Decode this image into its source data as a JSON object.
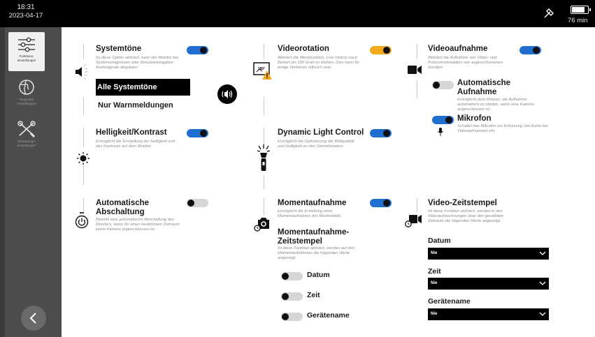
{
  "status_bar": {
    "time": "18:31",
    "date": "2023-04-17",
    "battery_text": "76 min",
    "battery_level_percent": 85
  },
  "sidebar": {
    "items": [
      {
        "label": "Funktions-\neinstellungen",
        "icon": "sliders-icon",
        "active": true
      },
      {
        "label": "Regionale\nEinstellungen",
        "icon": "globe-icon",
        "active": false
      },
      {
        "label": "Verwaltungs-\neinstellungen",
        "icon": "tools-icon",
        "active": false
      }
    ],
    "back_icon": "chevron-left-icon"
  },
  "settings": {
    "systemtoene": {
      "title": "Systemtöne",
      "desc": "Ist diese Option aktiviert, kann der Monitor bei Systemereignissen oder Benutzereingaben Audiosignale abspielen.",
      "on": true,
      "options": [
        "Alle Systemtöne",
        "Nur Warnmeldungen"
      ],
      "selected": "Alle Systemtöne"
    },
    "helligkeit": {
      "title": "Helligkeit/Kontrast",
      "desc": "Ermöglicht die Einstellung der Helligkeit und des Kontrasts auf dem Monitor.",
      "on": true
    },
    "abschaltung": {
      "title": "Automatische Abschaltung",
      "desc": "Bewirkt eine automatische Abschaltung des Monitors, wenn für einen bestimmten Zeitraum keine Kamera angeschlossen ist.",
      "on": false
    },
    "videorotation": {
      "title": "Videorotation",
      "desc": "Aktiviert die Menüfunktion, Live-Videos nach Bedarf um 180 Grad zu drehen. Dies kann für einige Verfahren hilfreich sein.",
      "on": true,
      "accent": "#f0aa1c"
    },
    "dlc": {
      "title": "Dynamic Light Control",
      "desc": "Ermöglicht die Optimierung der Bildqualität und Helligkeit an den Stimmbändern.",
      "on": true
    },
    "momentaufnahme": {
      "title": "Momentaufnahme",
      "desc": "Ermöglicht die Erstellung einer Momentaufnahme des Monitorbilds.",
      "on": true
    },
    "moment_zeitstempel": {
      "title": "Momentaufnahme-Zeitstempel",
      "desc": "Ist diese Funktion aktiviert, werden auf den Momentaufnahmen die folgenden Werte angezeigt.",
      "options": [
        {
          "label": "Datum",
          "on": false
        },
        {
          "label": "Zeit",
          "on": false
        },
        {
          "label": "Gerätename",
          "on": false
        }
      ]
    },
    "videoaufnahme": {
      "title": "Videoaufnahme",
      "desc": "Aktiviert die Aufnahme von Video- und Pulsoximetriedaten von angeschlossenen Geräten.",
      "on": true
    },
    "auto_aufnahme": {
      "title": "Automatische Aufnahme",
      "desc": "Ermöglicht dem Monitor, die Aufnahme automatisch zu starten, wenn eine Kamera angeschlossen ist.",
      "on": false
    },
    "mikrofon": {
      "title": "Mikrofon",
      "desc": "Schaltet das Mikrofon zur Erfassung von Audio bei Videoaufnahmen ein.",
      "on": true
    },
    "video_zeitstempel": {
      "title": "Video-Zeitstempel",
      "desc": "Ist diese Funktion aktiviert, werden in den Videoaufzeichnungen über den gewählten Zeitraum die folgenden Werte angezeigt.",
      "fields": [
        {
          "label": "Datum",
          "value": "Nie"
        },
        {
          "label": "Zeit",
          "value": "Nie"
        },
        {
          "label": "Gerätename",
          "value": "Nie"
        }
      ]
    }
  },
  "colors": {
    "accent": "#1f6fd1",
    "warning": "#f0aa1c",
    "sidebar": "#4d4d4d"
  }
}
